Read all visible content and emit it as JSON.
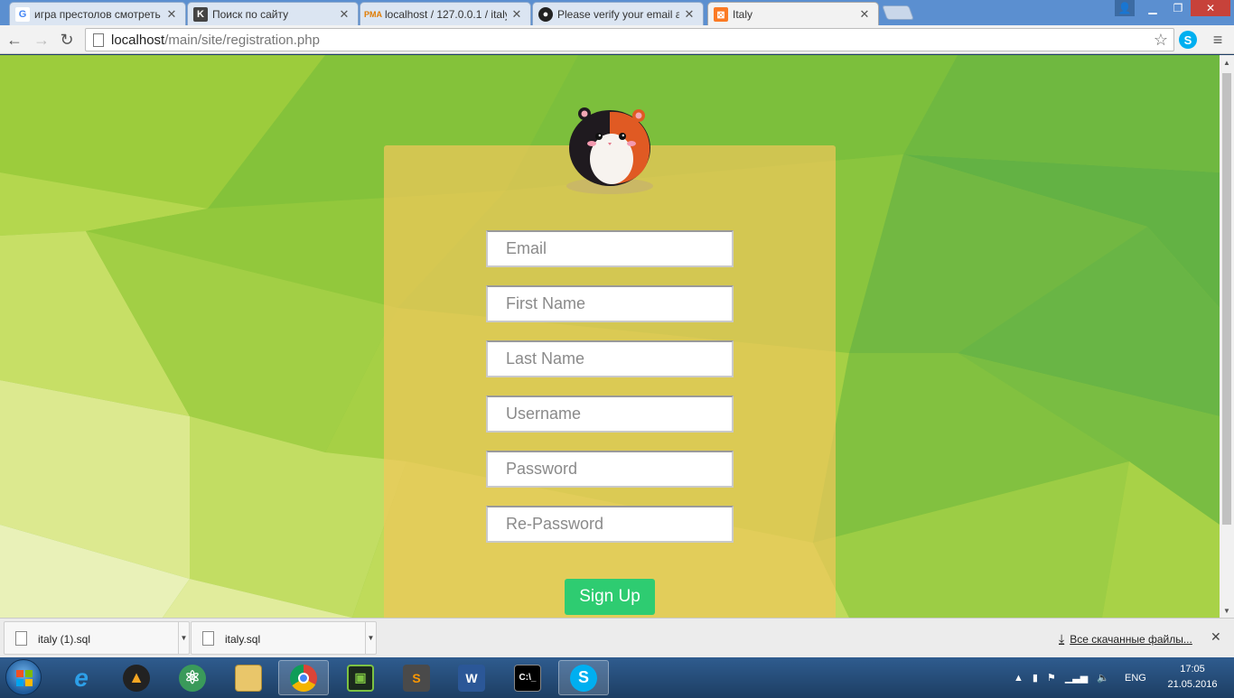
{
  "browser": {
    "tabs": [
      {
        "title": "игра престолов смотреть",
        "icon": "google-icon"
      },
      {
        "title": "Поиск по сайту",
        "icon": "k-icon"
      },
      {
        "title": "localhost / 127.0.0.1 / italy",
        "icon": "phpmyadmin-icon"
      },
      {
        "title": "Please verify your email ad",
        "icon": "github-icon"
      },
      {
        "title": "Italy",
        "icon": "xampp-icon",
        "active": true
      }
    ],
    "url_host": "localhost",
    "url_path": "/main/site/registration.php"
  },
  "form": {
    "email_placeholder": "Email",
    "first_name_placeholder": "First Name",
    "last_name_placeholder": "Last Name",
    "username_placeholder": "Username",
    "password_placeholder": "Password",
    "repassword_placeholder": "Re-Password",
    "submit_label": "Sign Up"
  },
  "downloads": {
    "items": [
      "italy (1).sql",
      "italy.sql"
    ],
    "show_all_label": "Все скачанные файлы..."
  },
  "taskbar": {
    "language": "ENG",
    "time": "17:05",
    "date": "21.05.2016"
  },
  "colors": {
    "card": "#f0c85a",
    "signup_button": "#2ecc71",
    "background": "#8cc63f"
  }
}
